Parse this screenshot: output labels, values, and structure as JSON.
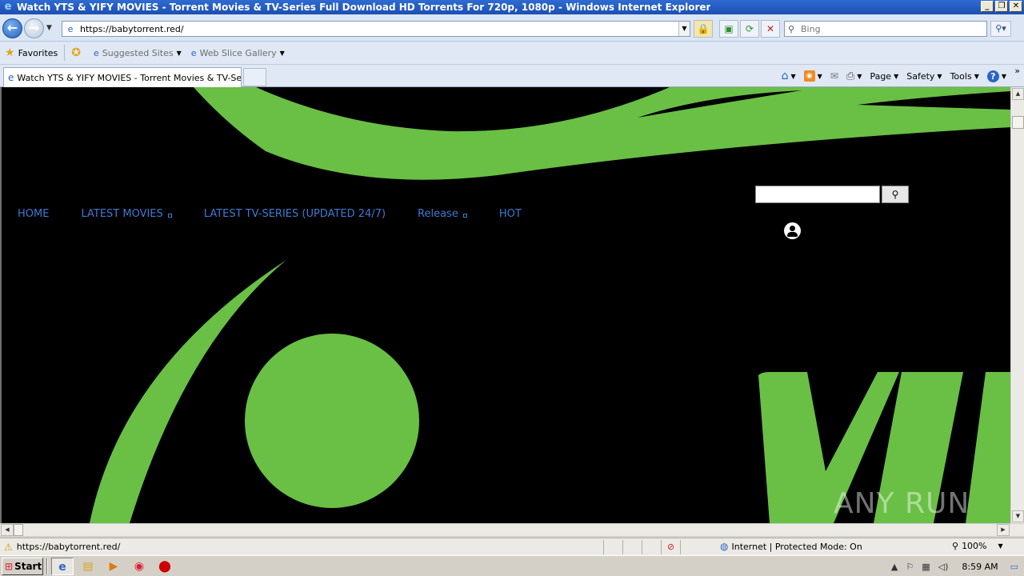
{
  "window": {
    "title": "Watch YTS & YIFY MOVIES - Torrent Movies & TV-Series Full Download HD Torrents For 720p, 1080p  - Windows Internet Explorer"
  },
  "address_bar": {
    "url": "https://babytorrent.red/"
  },
  "search_box": {
    "placeholder": "Bing"
  },
  "favorites_bar": {
    "favorites_label": "Favorites",
    "suggested_sites_label": "Suggested Sites",
    "web_slice_label": "Web Slice Gallery"
  },
  "tab": {
    "label": "Watch YTS & YIFY MOVIES - Torrent Movies & TV-Seri..."
  },
  "command_bar": {
    "page_label": "Page",
    "safety_label": "Safety",
    "tools_label": "Tools"
  },
  "site_nav": {
    "items": [
      {
        "label": "HOME",
        "has_submenu": false
      },
      {
        "label": "LATEST MOVIES",
        "has_submenu": true
      },
      {
        "label": "LATEST TV-SERIES (UPDATED 24/7)",
        "has_submenu": false
      },
      {
        "label": "Release",
        "has_submenu": true
      },
      {
        "label": "HOT",
        "has_submenu": false
      }
    ]
  },
  "watermark": {
    "text": "ANY RUN"
  },
  "status_bar": {
    "url": "https://babytorrent.red/",
    "zone": "Internet | Protected Mode: On",
    "zoom": "100%"
  },
  "taskbar": {
    "start_label": "Start",
    "clock": "8:59 AM"
  },
  "colors": {
    "accent_green": "#6abf45",
    "nav_link": "#3f7ad4",
    "title_bar": "#1c4fb3"
  }
}
